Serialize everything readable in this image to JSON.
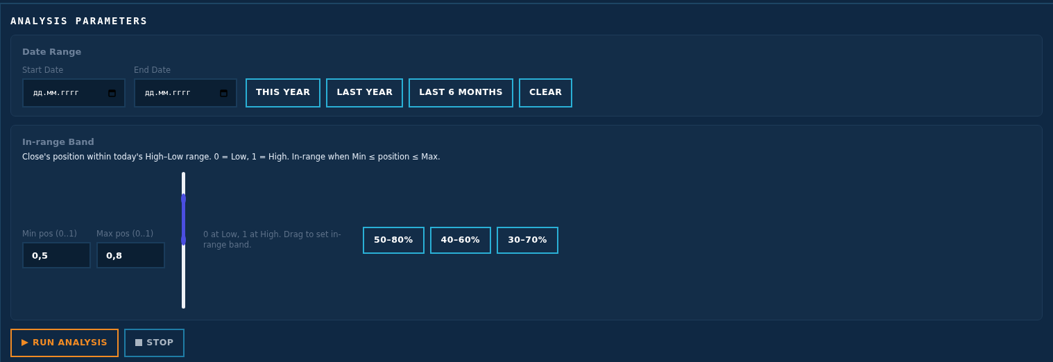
{
  "title": "ANALYSIS PARAMETERS",
  "date_range": {
    "heading": "Date Range",
    "fields": [
      {
        "label": "Start Date",
        "placeholder": "дд.мм.гггг"
      },
      {
        "label": "End Date",
        "placeholder": "дд.мм.гггг"
      }
    ],
    "presets": [
      "THIS YEAR",
      "LAST YEAR",
      "LAST 6 MONTHS",
      "CLEAR"
    ]
  },
  "band": {
    "heading": "In-range Band",
    "description": "Close's position within today's High–Low range. 0 = Low, 1 = High. In-range when Min ≤ position ≤ Max.",
    "fields": [
      {
        "label": "Min pos (0..1)",
        "value": "0,5"
      },
      {
        "label": "Max pos (0..1)",
        "value": "0,8"
      }
    ],
    "slider": {
      "thumbs": [
        {
          "level": 0.5
        },
        {
          "level": 0.8
        }
      ]
    },
    "hint": "0 at Low, 1 at High. Drag to set in-range band.",
    "presets": [
      "50–80%",
      "40–60%",
      "30–70%"
    ]
  },
  "actions": [
    {
      "kind": "run",
      "label": "RUN ANALYSIS"
    },
    {
      "kind": "stop",
      "label": "STOP"
    }
  ]
}
